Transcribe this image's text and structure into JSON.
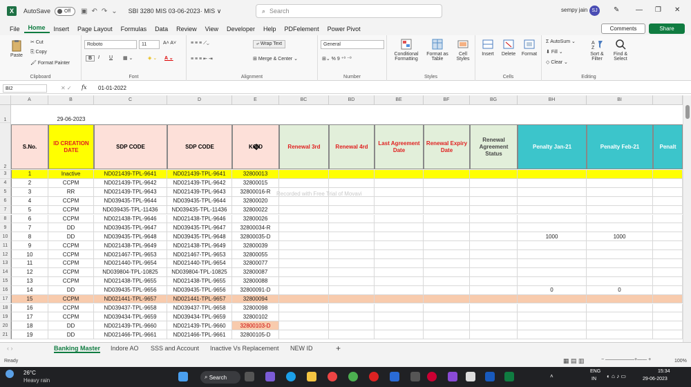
{
  "titlebar": {
    "autosave_label": "AutoSave",
    "autosave_state": "Off",
    "filename": "SBI 3280 MIS 03-06-2023· MIS ∨",
    "search_placeholder": "Search",
    "user_name": "sempy jain",
    "user_initials": "SJ"
  },
  "menu": {
    "tabs": [
      "File",
      "Home",
      "Insert",
      "Page Layout",
      "Formulas",
      "Data",
      "Review",
      "View",
      "Developer",
      "Help",
      "PDFelement",
      "Power Pivot"
    ],
    "active": "Home",
    "comments_label": "Comments",
    "share_label": "Share"
  },
  "ribbon": {
    "clipboard": {
      "paste": "Paste",
      "cut": "Cut",
      "copy": "Copy",
      "format_painter": "Format Painter",
      "group": "Clipboard"
    },
    "font": {
      "name": "Roboto",
      "size": "11",
      "bold": "B",
      "italic": "I",
      "underline": "U",
      "group": "Font"
    },
    "alignment": {
      "wrap": "Wrap Text",
      "merge": "Merge & Center",
      "group": "Alignment"
    },
    "number": {
      "format": "General",
      "group": "Number"
    },
    "styles": {
      "conditional": "Conditional Formatting",
      "format_table": "Format as Table",
      "cell_styles": "Cell Styles",
      "group": "Styles"
    },
    "cells": {
      "insert": "Insert",
      "delete": "Delete",
      "format": "Format",
      "group": "Cells"
    },
    "editing": {
      "autosum": "AutoSum",
      "fill": "Fill",
      "clear": "Clear",
      "sort": "Sort & Filter",
      "find": "Find & Select",
      "group": "Editing"
    }
  },
  "formula_bar": {
    "name_box": "BI2",
    "formula": "01-01-2022"
  },
  "columns": [
    "A",
    "B",
    "C",
    "D",
    "E",
    "BC",
    "BD",
    "BE",
    "BF",
    "BG",
    "BH",
    "BI"
  ],
  "sheet": {
    "date_cell": "29-06-2023",
    "headers": [
      "S.No.",
      "ID CREATION DATE",
      "SDP CODE",
      "SDP CODE",
      "KOID",
      "Renewal 3rd",
      "Renewal 4rd",
      "Last Agreement Date",
      "Renewal Expiry Date",
      "Renewal Agreement Status",
      "Penalty Jan-21",
      "Penalty Feb-21",
      "Penalt"
    ],
    "row_numbers": [
      "1",
      "2",
      "3",
      "4",
      "5",
      "6",
      "7",
      "8",
      "9",
      "10",
      "11",
      "12",
      "13",
      "14",
      "15",
      "16",
      "17",
      "18",
      "19",
      "20",
      "21"
    ],
    "watermark": "Recorded with Free Trial of Movavi",
    "rows": [
      {
        "sno": "1",
        "status": "Inactive",
        "sdp1": "ND021439-TPL-9641",
        "sdp2": "ND021439-TPL-9641",
        "koid": "32800013",
        "pj": "",
        "pf": ""
      },
      {
        "sno": "2",
        "status": "CCPM",
        "sdp1": "ND021439-TPL-9642",
        "sdp2": "ND021439-TPL-9642",
        "koid": "32800015",
        "pj": "",
        "pf": ""
      },
      {
        "sno": "3",
        "status": "RR",
        "sdp1": "ND021439-TPL-9643",
        "sdp2": "ND021439-TPL-9643",
        "koid": "32800016-R",
        "pj": "",
        "pf": ""
      },
      {
        "sno": "4",
        "status": "CCPM",
        "sdp1": "ND039435-TPL-9644",
        "sdp2": "ND039435-TPL-9644",
        "koid": "32800020",
        "pj": "",
        "pf": ""
      },
      {
        "sno": "5",
        "status": "CCPM",
        "sdp1": "ND039435-TPL-11436",
        "sdp2": "ND039435-TPL-11436",
        "koid": "32800022",
        "pj": "",
        "pf": ""
      },
      {
        "sno": "6",
        "status": "CCPM",
        "sdp1": "ND021438-TPL-9646",
        "sdp2": "ND021438-TPL-9646",
        "koid": "32800026",
        "pj": "",
        "pf": ""
      },
      {
        "sno": "7",
        "status": "DD",
        "sdp1": "ND039435-TPL-9647",
        "sdp2": "ND039435-TPL-9647",
        "koid": "32800034-R",
        "pj": "",
        "pf": ""
      },
      {
        "sno": "8",
        "status": "DD",
        "sdp1": "ND039435-TPL-9648",
        "sdp2": "ND039435-TPL-9648",
        "koid": "32800035-D",
        "pj": "1000",
        "pf": "1000"
      },
      {
        "sno": "9",
        "status": "CCPM",
        "sdp1": "ND021438-TPL-9649",
        "sdp2": "ND021438-TPL-9649",
        "koid": "32800039",
        "pj": "",
        "pf": ""
      },
      {
        "sno": "10",
        "status": "CCPM",
        "sdp1": "ND021467-TPL-9653",
        "sdp2": "ND021467-TPL-9653",
        "koid": "32800055",
        "pj": "",
        "pf": ""
      },
      {
        "sno": "11",
        "status": "CCPM",
        "sdp1": "ND021440-TPL-9654",
        "sdp2": "ND021440-TPL-9654",
        "koid": "32800077",
        "pj": "",
        "pf": ""
      },
      {
        "sno": "12",
        "status": "CCPM",
        "sdp1": "ND039804-TPL-10825",
        "sdp2": "ND039804-TPL-10825",
        "koid": "32800087",
        "pj": "",
        "pf": ""
      },
      {
        "sno": "13",
        "status": "CCPM",
        "sdp1": "ND021438-TPL-9655",
        "sdp2": "ND021438-TPL-9655",
        "koid": "32800088",
        "pj": "",
        "pf": ""
      },
      {
        "sno": "14",
        "status": "DD",
        "sdp1": "ND039435-TPL-9656",
        "sdp2": "ND039435-TPL-9656",
        "koid": "32800091-D",
        "pj": "0",
        "pf": "0"
      },
      {
        "sno": "15",
        "status": "CCPM",
        "sdp1": "ND021441-TPL-9657",
        "sdp2": "ND021441-TPL-9657",
        "koid": "32800094",
        "pj": "",
        "pf": ""
      },
      {
        "sno": "16",
        "status": "CCPM",
        "sdp1": "ND039437-TPL-9658",
        "sdp2": "ND039437-TPL-9658",
        "koid": "32800098",
        "pj": "",
        "pf": ""
      },
      {
        "sno": "17",
        "status": "CCPM",
        "sdp1": "ND039434-TPL-9659",
        "sdp2": "ND039434-TPL-9659",
        "koid": "32800102",
        "pj": "",
        "pf": ""
      },
      {
        "sno": "18",
        "status": "DD",
        "sdp1": "ND021439-TPL-9660",
        "sdp2": "ND021439-TPL-9660",
        "koid": "32800103-D",
        "pj": "",
        "pf": ""
      },
      {
        "sno": "19",
        "status": "DD",
        "sdp1": "ND021466-TPL-9661",
        "sdp2": "ND021466-TPL-9661",
        "koid": "32800105-D",
        "pj": "",
        "pf": ""
      }
    ]
  },
  "sheet_tabs": [
    "Banking Master",
    "Indore AO",
    "SSS and Account",
    "Inactive Vs Replacement",
    "NEW ID"
  ],
  "active_sheet": "Banking Master",
  "statusbar": {
    "ready": "Ready",
    "zoom": "100%"
  },
  "taskbar": {
    "weather_temp": "26°C",
    "weather_desc": "Heavy rain",
    "search": "Search",
    "lang1": "ENG",
    "lang2": "IN",
    "time": "15:34",
    "date": "29-06-2023"
  },
  "colors": {
    "excel_green": "#107c41",
    "yellow": "#ffff00",
    "salmon": "#f8cbad",
    "teal": "#3cc5cb",
    "header_pink": "#fde0d9"
  }
}
